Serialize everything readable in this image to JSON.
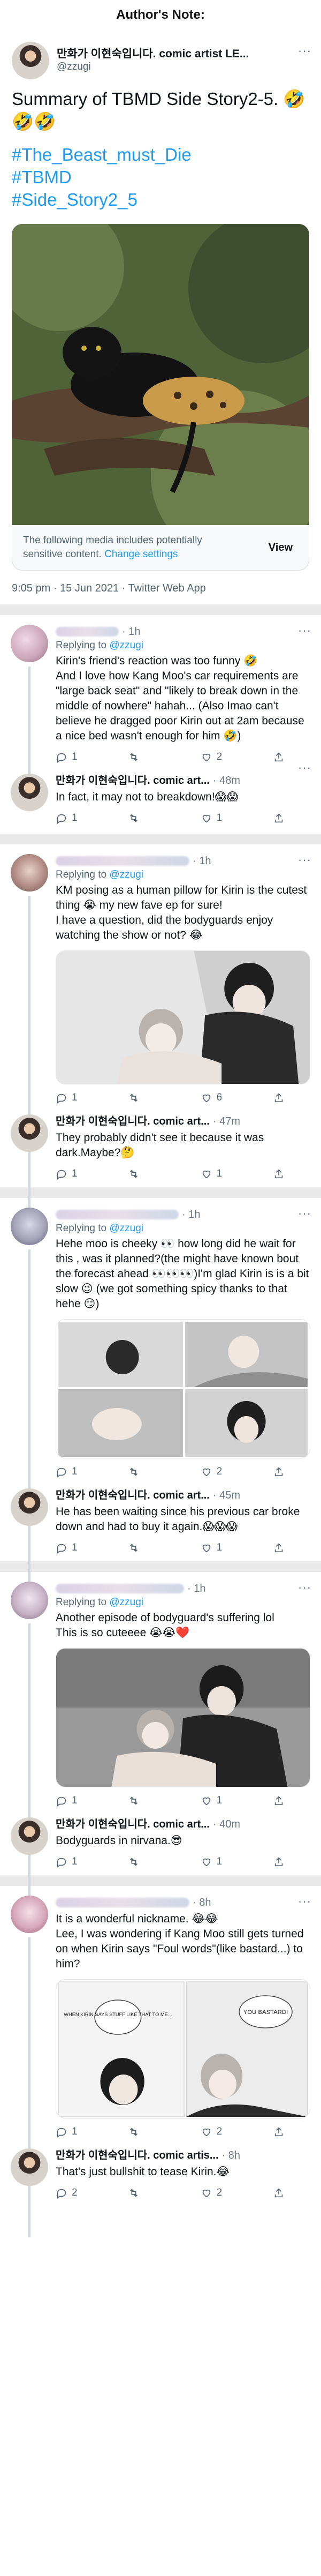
{
  "header": {
    "title": "Author's Note:"
  },
  "main_tweet": {
    "author_name": "만화가 이현숙입니다. comic artist LE...",
    "handle": "@zzugi",
    "text": "Summary of TBMD Side Story2-5. 🤣🤣🤣",
    "hashtags": [
      "#The_Beast_must_Die",
      "#TBMD",
      "#Side_Story2_5"
    ],
    "sensitive_notice": "The following media includes potentially sensitive content.",
    "sensitive_link": "Change settings",
    "view_label": "View",
    "timestamp": "9:05 pm · 15 Jun 2021 · Twitter Web App"
  },
  "replies": [
    {
      "time": "· 1h",
      "reply_to_label": "Replying to",
      "reply_to": "@zzugi",
      "text": "Kirin's friend's reaction was too funny 🤣\nAnd I love how Kang Moo's car requirements are \"large back seat\" and \"likely to break down in the middle of nowhere\" hahah... (Also Imao can't believe he dragged poor Kirin out at 2am because a nice bed wasn't enough for him 🤣)",
      "counts": {
        "reply": "1",
        "retweet": "",
        "like": "2"
      },
      "author_reply": {
        "name": "만화가 이현숙입니다. comic art...",
        "time": "· 48m",
        "text": "In fact, it may not to breakdown!😱😱",
        "counts": {
          "reply": "1",
          "retweet": "",
          "like": "1"
        }
      }
    },
    {
      "time": "· 1h",
      "reply_to_label": "Replying to",
      "reply_to": "@zzugi",
      "text": "KM posing as a human pillow for Kirin is the cutest thing 😭 my new fave ep for sure!\nI have a question, did the bodyguards enjoy watching the show or not? 😂",
      "counts": {
        "reply": "1",
        "retweet": "",
        "like": "6"
      },
      "author_reply": {
        "name": "만화가 이현숙입니다. comic art...",
        "time": "· 47m",
        "text": "They probably didn't see it because it was dark.Maybe?🤔",
        "counts": {
          "reply": "1",
          "retweet": "",
          "like": "1"
        }
      }
    },
    {
      "time": "· 1h",
      "reply_to_label": "Replying to",
      "reply_to": "@zzugi",
      "text": "Hehe moo is cheeky 👀 how long did he wait for this , was it planned?(the might have known bout the forecast ahead 👀👀👀)I'm glad Kirin is is a bit slow 😉 (we got something spicy thanks to that hehe 😏)",
      "counts": {
        "reply": "1",
        "retweet": "",
        "like": "2"
      },
      "author_reply": {
        "name": "만화가 이현숙입니다. comic art...",
        "time": "· 45m",
        "text": "He has been waiting since his previous car broke down and had to buy it again.😱😱😱",
        "counts": {
          "reply": "1",
          "retweet": "",
          "like": "1"
        }
      }
    },
    {
      "time": "· 1h",
      "reply_to_label": "Replying to",
      "reply_to": "@zzugi",
      "text": "Another episode of bodyguard's suffering lol\nThis is so cuteeee 😭😭❤️",
      "counts": {
        "reply": "1",
        "retweet": "",
        "like": "1"
      },
      "author_reply": {
        "name": "만화가 이현숙입니다. comic art...",
        "time": "· 40m",
        "text": "Bodyguards in nirvana.😎",
        "counts": {
          "reply": "1",
          "retweet": "",
          "like": "1"
        }
      }
    },
    {
      "time": "· 8h",
      "reply_to_label": "",
      "reply_to": "",
      "text": "It is a wonderful nickname. 😂😂\nLee, I was wondering if Kang Moo still gets turned on when Kirin says \"Foul words\"(like bastard...) to him?",
      "comic_text_left": "WHEN KIRIN SAYS STUFF LIKE THAT TO ME...",
      "comic_text_right": "YOU BASTARD!",
      "counts": {
        "reply": "1",
        "retweet": "",
        "like": "2"
      },
      "author_reply": {
        "name": "만화가 이현숙입니다. comic artis...",
        "time": "· 8h",
        "text": "That's just bullshit to tease Kirin.😂",
        "counts": {
          "reply": "2",
          "retweet": "",
          "like": "2"
        }
      }
    }
  ],
  "colors": {
    "link": "#1d9bf0",
    "muted": "#536471",
    "separator": "#e9e9e9"
  },
  "icons": [
    "more-icon",
    "reply-icon",
    "retweet-icon",
    "like-icon",
    "share-icon"
  ]
}
